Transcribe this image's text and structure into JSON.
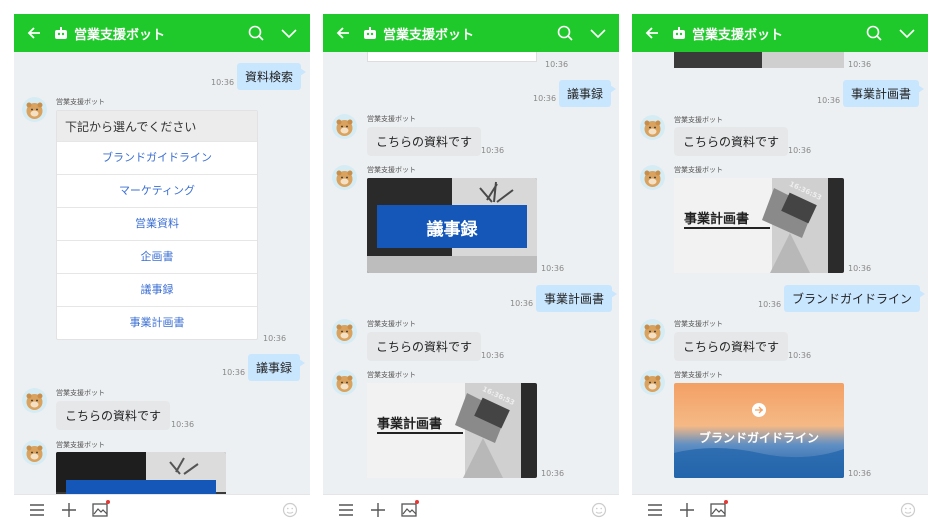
{
  "app": {
    "title": "営業支援ボット"
  },
  "bot_name": "営業支援ボット",
  "panel1": {
    "user_msg_1": {
      "text": "資料検索",
      "time": "10:36"
    },
    "menu": {
      "header": "下記から選んでください",
      "items": [
        "ブランドガイドライン",
        "マーケティング",
        "営業資料",
        "企画書",
        "議事録",
        "事業計画書"
      ],
      "time": "10:36"
    },
    "user_msg_2": {
      "text": "議事録",
      "time": "10:36"
    },
    "bot_msg": {
      "text": "こちらの資料です",
      "time": "10:36"
    }
  },
  "panel2": {
    "top_time": "10:36",
    "user_msg_1": {
      "text": "議事録",
      "time": "10:36"
    },
    "bot_msg_1": {
      "text": "こちらの資料です",
      "time": "10:36"
    },
    "card_1": {
      "title": "議事録",
      "time": "10:36"
    },
    "user_msg_2": {
      "text": "事業計画書",
      "time": "10:36"
    },
    "bot_msg_2": {
      "text": "こちらの資料です",
      "time": "10:36"
    },
    "card_2": {
      "title": "事業計画書",
      "clock": "16:36:53",
      "time": "10:36"
    }
  },
  "panel3": {
    "top_time": "10:36",
    "user_msg_1": {
      "text": "事業計画書",
      "time": "10:36"
    },
    "bot_msg_1": {
      "text": "こちらの資料です",
      "time": "10:36"
    },
    "card_1": {
      "title": "事業計画書",
      "clock": "16:36:53",
      "time": "10:36"
    },
    "user_msg_2": {
      "text": "ブランドガイドライン",
      "time": "10:36"
    },
    "bot_msg_2": {
      "text": "こちらの資料です",
      "time": "10:36"
    },
    "card_2": {
      "title": "ブランドガイドライン",
      "time": "10:36"
    }
  },
  "colors": {
    "header": "#20c92b",
    "user_bubble": "#c9e6ff",
    "bot_bubble": "#e6e7e9",
    "link": "#3b6fd3",
    "card_blue": "#1457b8"
  },
  "icons": [
    "back-arrow-icon",
    "bot-icon",
    "search-icon",
    "chevron-down-icon",
    "menu-icon",
    "plus-icon",
    "image-icon",
    "emoji-icon"
  ]
}
